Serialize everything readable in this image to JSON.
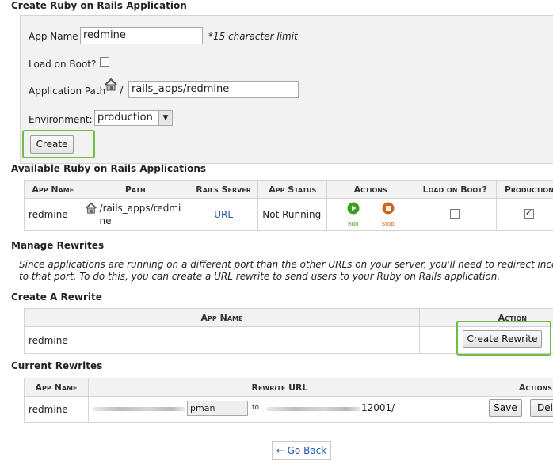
{
  "create_app": {
    "title": "Create Ruby on Rails Application",
    "app_name_label": "App Name",
    "app_name_value": "redmine",
    "char_limit_note": "*15 character limit",
    "load_on_boot_label": "Load on Boot?",
    "app_path_label": "Application Path",
    "app_path_separator": "/",
    "app_path_value": "rails_apps/redmine",
    "environment_label": "Environment:",
    "environment_value": "production",
    "create_button": "Create"
  },
  "available_apps": {
    "title": "Available Ruby on Rails Applications",
    "columns": [
      "App Name",
      "Path",
      "Rails Server",
      "App Status",
      "Actions",
      "Load on Boot?",
      "Production"
    ],
    "rows": [
      {
        "app_name": "redmine",
        "path": "/rails_apps/redmine",
        "rails_server": "URL",
        "status": "Not Running",
        "run_label": "Run",
        "stop_label": "Stop",
        "load_on_boot": false,
        "production": true
      }
    ]
  },
  "manage_rewrites": {
    "title": "Manage Rewrites",
    "description": "Since applications are running on a different port than the other URLs on your server, you'll need to redirect incoming to that port. To do this, you can create a URL rewrite to send users to your Ruby on Rails application.",
    "description_line1": "Since applications are running on a different port than the other URLs on your server, you'll need to redirect incoming",
    "description_line2": "to that port. To do this, you can create a URL rewrite to send users to your Ruby on Rails application."
  },
  "create_rewrite": {
    "title": "Create A Rewrite",
    "columns": [
      "App Name",
      "Action"
    ],
    "row": {
      "app_name": "redmine",
      "button": "Create Rewrite"
    }
  },
  "current_rewrites": {
    "title": "Current Rewrites",
    "columns": [
      "App Name",
      "Rewrite URL",
      "Actions"
    ],
    "row": {
      "app_name": "redmine",
      "path_value": "pman",
      "to_label": "to",
      "target_suffix": "12001/",
      "save_button": "Save",
      "delete_button": "Del"
    }
  },
  "go_back": "← Go Back",
  "colors": {
    "highlight": "#6fbf47",
    "run": "#3aa21a",
    "stop": "#d0651d",
    "link": "#2255aa"
  },
  "icons": [
    "home-icon",
    "run-icon",
    "stop-icon",
    "dropdown-arrow-icon",
    "arrow-icon"
  ]
}
